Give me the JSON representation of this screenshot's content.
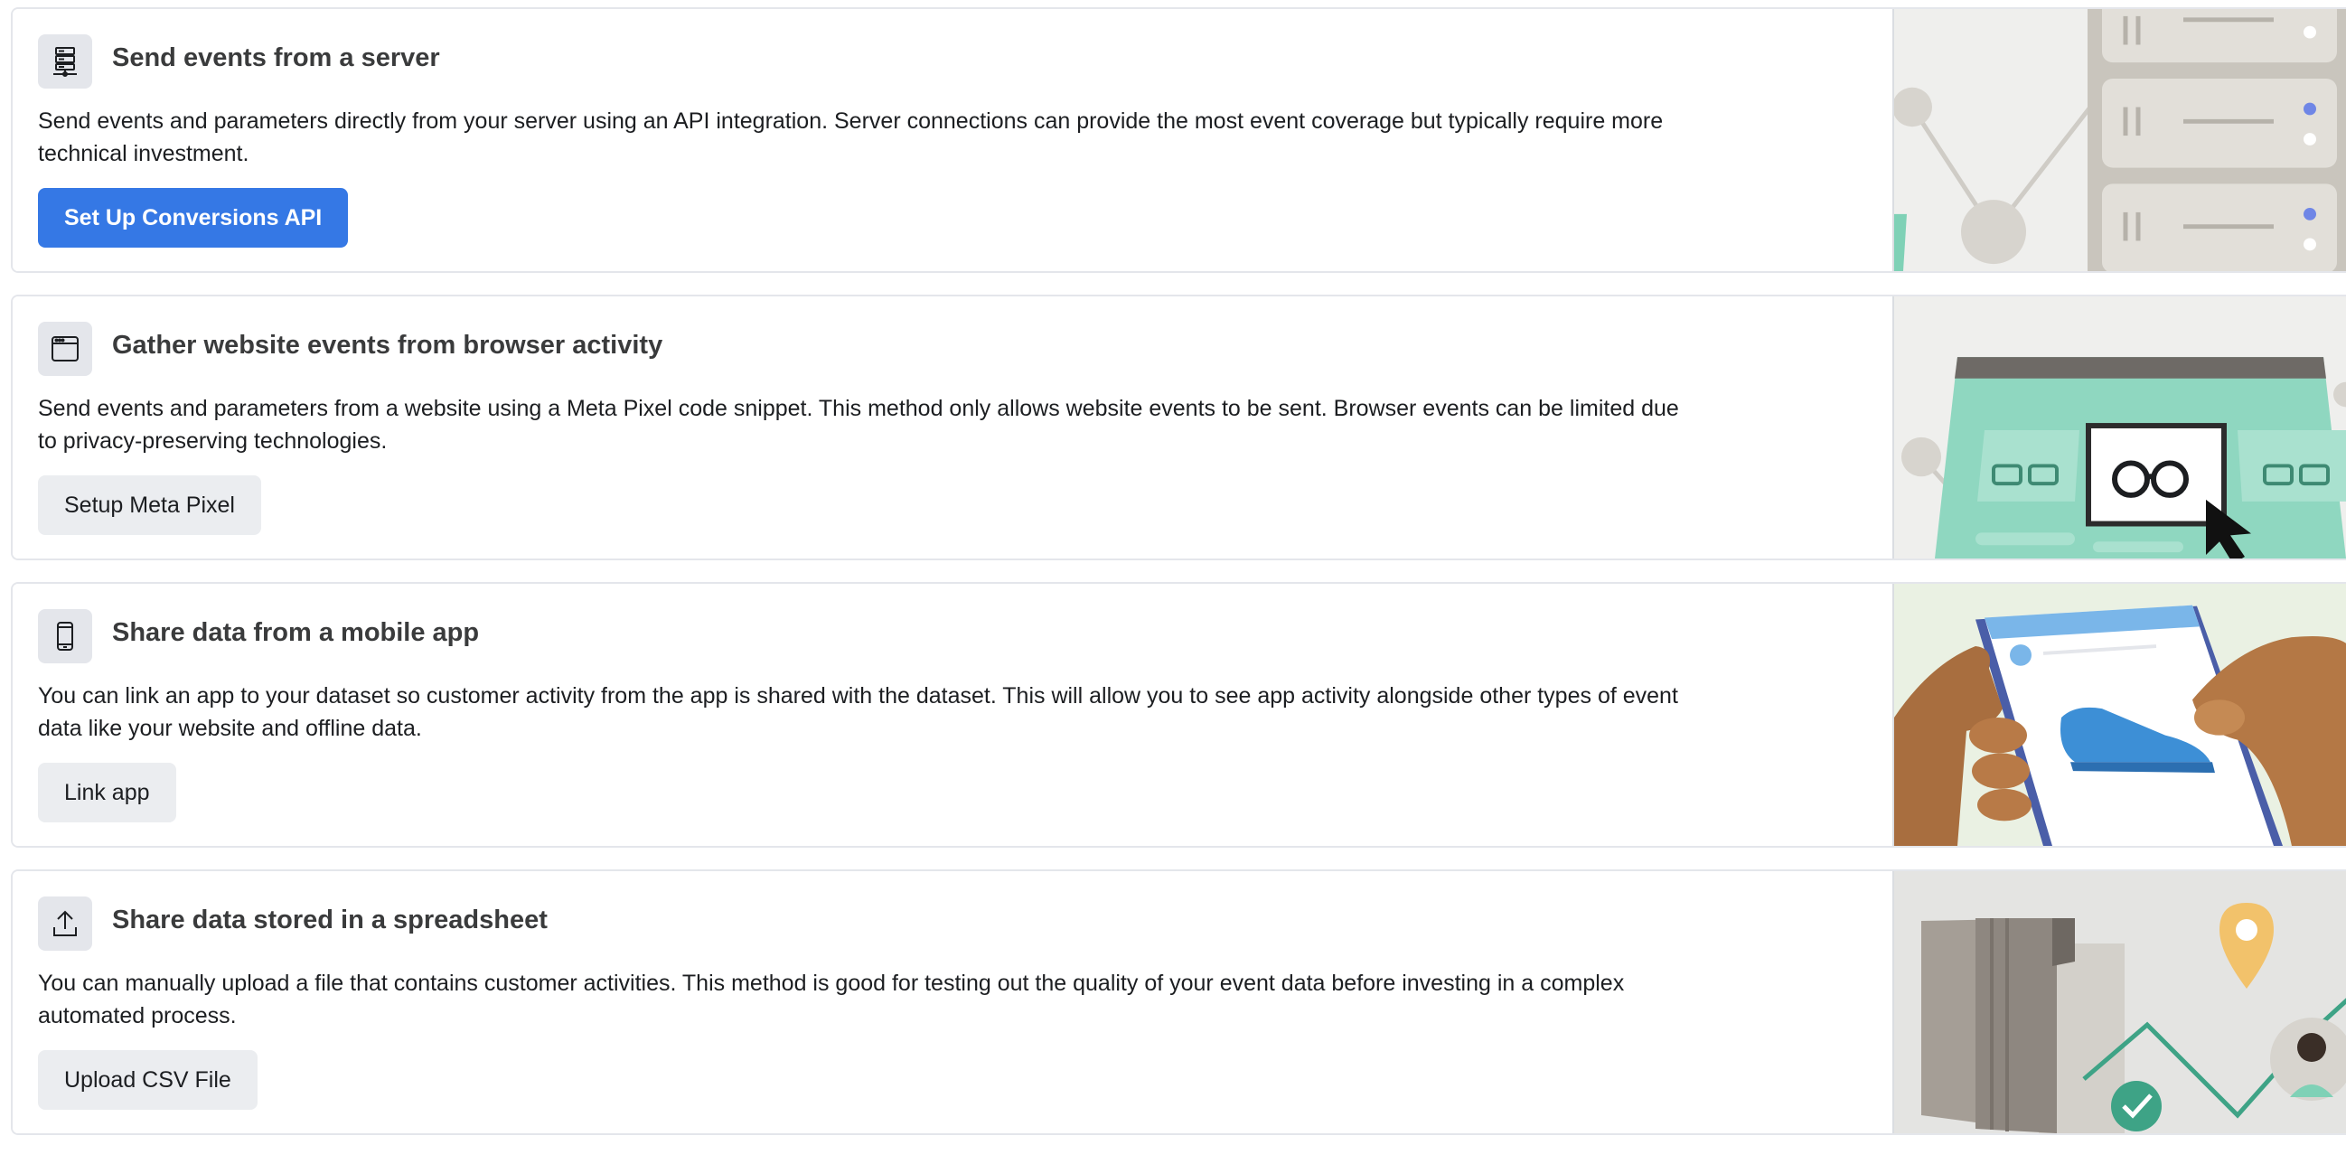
{
  "cards": [
    {
      "title": "Send events from a server",
      "description": "Send events and parameters directly from your server using an API integration. Server connections can provide the most event coverage but typically require more technical investment.",
      "button_label": "Set Up Conversions API",
      "icon": "server-icon",
      "illustration": "server-rack-illustration"
    },
    {
      "title": "Gather website events from browser activity",
      "description": "Send events and parameters from a website using a Meta Pixel code snippet. This method only allows website events to be sent. Browser events can be limited due to privacy-preserving technologies.",
      "button_label": "Setup Meta Pixel",
      "icon": "browser-window-icon",
      "illustration": "browser-glasses-illustration"
    },
    {
      "title": "Share data from a mobile app",
      "description": "You can link an app to your dataset so customer activity from the app is shared with the dataset. This will allow you to see app activity alongside other types of event data like your website and offline data.",
      "button_label": "Link app",
      "icon": "mobile-phone-icon",
      "illustration": "phone-in-hands-illustration"
    },
    {
      "title": "Share data stored in a spreadsheet",
      "description": "You can manually upload a file that contains customer activities. This method is good for testing out the quality of your event data before investing in a complex automated process.",
      "button_label": "Upload CSV File",
      "icon": "upload-icon",
      "illustration": "file-upload-illustration"
    }
  ],
  "colors": {
    "primary_button": "#3578e5",
    "secondary_button": "#ebedf0",
    "icon_box": "#e4e6eb",
    "card_border": "#e4e6eb",
    "title": "#3a3b3c"
  }
}
